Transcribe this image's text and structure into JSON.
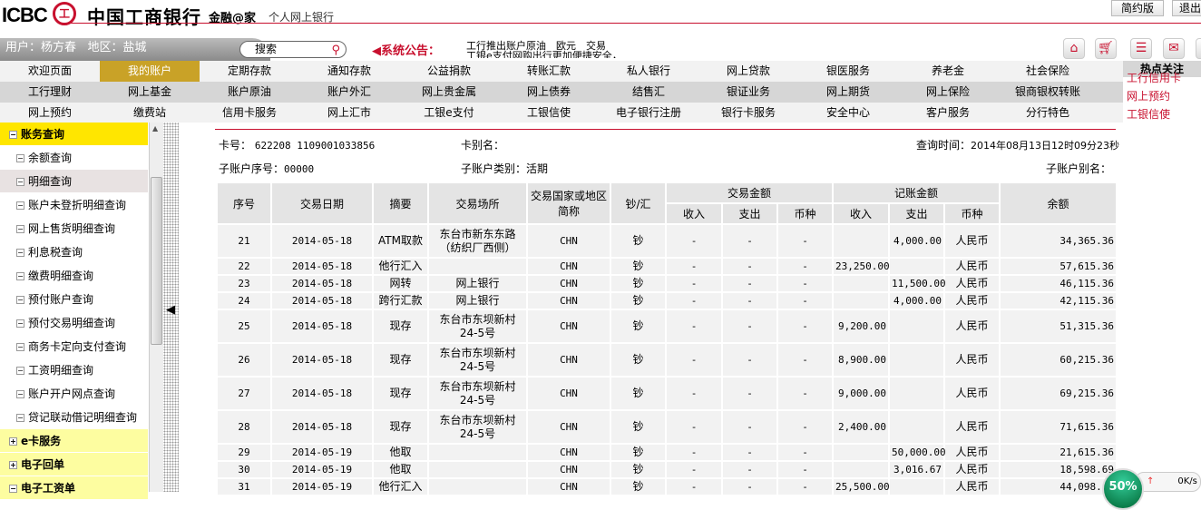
{
  "header": {
    "logo_text": "ICBC",
    "seal": "工",
    "bank_name": "中国工商银行",
    "slogan": "金融@家",
    "subtitle": "个人网上银行",
    "simple_btn": "简约版",
    "logout_btn": "退出"
  },
  "userbar": {
    "user_label": "用户：",
    "user": "杨方春",
    "region_label": "地区：",
    "region": "盐城",
    "search_placeholder": "搜索",
    "notice_label": "系统公告：",
    "notice_lines": [
      "工行推出账户原油　欧元　交易",
      "工银e支付网购出行更加便捷安全，"
    ]
  },
  "nav": {
    "row1": [
      "欢迎页面",
      "我的账户",
      "定期存款",
      "通知存款",
      "公益捐款",
      "转账汇款",
      "私人银行",
      "网上贷款",
      "银医服务",
      "养老金",
      "社会保险"
    ],
    "row2": [
      "工行理财",
      "网上基金",
      "账户原油",
      "账户外汇",
      "网上贵金属",
      "网上债券",
      "结售汇",
      "银证业务",
      "网上期货",
      "网上保险",
      "银商银权转账"
    ],
    "row3": [
      "网上预约",
      "缴费站",
      "信用卡服务",
      "网上汇市",
      "工银e支付",
      "工银信使",
      "电子银行注册",
      "银行卡服务",
      "安全中心",
      "客户服务",
      "分行特色"
    ],
    "active": "我的账户"
  },
  "hot": {
    "title": "热点关注",
    "links": [
      "工行信用卡",
      "网上预约",
      "工银信使"
    ]
  },
  "sidebar": {
    "group": "账务查询",
    "items": [
      "余额查询",
      "明细查询",
      "账户未登折明细查询",
      "网上售货明细查询",
      "利息税查询",
      "缴费明细查询",
      "预付账户查询",
      "预付交易明细查询",
      "商务卡定向支付查询",
      "工资明细查询",
      "账户开户网点查询",
      "贷记联动借记明细查询"
    ],
    "selected": "明细查询",
    "groups": [
      "e卡服务",
      "电子回单",
      "电子工资单"
    ]
  },
  "info": {
    "card_label": "卡号：",
    "card_no": "622208 1109001033856",
    "alias_label": "卡别名：",
    "query_time_label": "查询时间：",
    "query_time": "2014年08月13日12时09分23秒",
    "sub_no_label": "子账户序号：",
    "sub_no": "00000",
    "sub_type_label": "子账户类别：",
    "sub_type": "活期",
    "sub_alias_label": "子账户别名："
  },
  "table": {
    "headers": {
      "seq": "序号",
      "date": "交易日期",
      "summary": "摘要",
      "place": "交易场所",
      "country": "交易国家或地区简称",
      "cash": "钞/汇",
      "txn_amount": "交易金额",
      "book_amount": "记账金额",
      "income": "收入",
      "expense": "支出",
      "currency": "币种",
      "balance": "余额"
    },
    "rows": [
      [
        "21",
        "2014-05-18",
        "ATM取款",
        "东台市新东东路（纺织厂西侧）",
        "CHN",
        "钞",
        "-",
        "-",
        "-",
        "",
        "4,000.00",
        "人民币",
        "34,365.36"
      ],
      [
        "22",
        "2014-05-18",
        "他行汇入",
        "",
        "CHN",
        "钞",
        "-",
        "-",
        "-",
        "23,250.00",
        "",
        "人民币",
        "57,615.36"
      ],
      [
        "23",
        "2014-05-18",
        "网转",
        "网上银行",
        "CHN",
        "钞",
        "-",
        "-",
        "-",
        "",
        "11,500.00",
        "人民币",
        "46,115.36"
      ],
      [
        "24",
        "2014-05-18",
        "跨行汇款",
        "网上银行",
        "CHN",
        "钞",
        "-",
        "-",
        "-",
        "",
        "4,000.00",
        "人民币",
        "42,115.36"
      ],
      [
        "25",
        "2014-05-18",
        "现存",
        "东台市东坝新村24-5号",
        "CHN",
        "钞",
        "-",
        "-",
        "-",
        "9,200.00",
        "",
        "人民币",
        "51,315.36"
      ],
      [
        "26",
        "2014-05-18",
        "现存",
        "东台市东坝新村24-5号",
        "CHN",
        "钞",
        "-",
        "-",
        "-",
        "8,900.00",
        "",
        "人民币",
        "60,215.36"
      ],
      [
        "27",
        "2014-05-18",
        "现存",
        "东台市东坝新村24-5号",
        "CHN",
        "钞",
        "-",
        "-",
        "-",
        "9,000.00",
        "",
        "人民币",
        "69,215.36"
      ],
      [
        "28",
        "2014-05-18",
        "现存",
        "东台市东坝新村24-5号",
        "CHN",
        "钞",
        "-",
        "-",
        "-",
        "2,400.00",
        "",
        "人民币",
        "71,615.36"
      ],
      [
        "29",
        "2014-05-19",
        "他取",
        "",
        "CHN",
        "钞",
        "-",
        "-",
        "-",
        "",
        "50,000.00",
        "人民币",
        "21,615.36"
      ],
      [
        "30",
        "2014-05-19",
        "他取",
        "",
        "CHN",
        "钞",
        "-",
        "-",
        "-",
        "",
        "3,016.67",
        "人民币",
        "18,598.69"
      ],
      [
        "31",
        "2014-05-19",
        "他行汇入",
        "",
        "CHN",
        "钞",
        "-",
        "-",
        "-",
        "25,500.00",
        "",
        "人民币",
        "44,098.69"
      ]
    ]
  },
  "widget": {
    "percent": "50%",
    "speed": "0K/s"
  }
}
